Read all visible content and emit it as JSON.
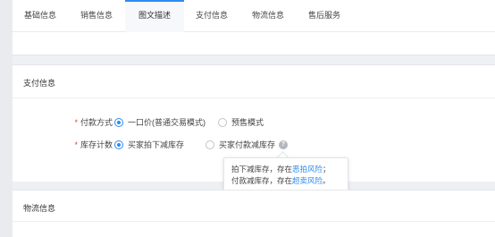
{
  "tabs": [
    {
      "label": "基础信息",
      "active": false
    },
    {
      "label": "销售信息",
      "active": false
    },
    {
      "label": "图文描述",
      "active": true
    },
    {
      "label": "支付信息",
      "active": false
    },
    {
      "label": "物流信息",
      "active": false
    },
    {
      "label": "售后服务",
      "active": false
    }
  ],
  "payment": {
    "title": "支付信息",
    "method": {
      "label": "付款方式",
      "options": [
        {
          "label": "一口价(普通交易模式)",
          "selected": true
        },
        {
          "label": "预售模式",
          "selected": false
        }
      ]
    },
    "inventory": {
      "label": "库存计数",
      "options": [
        {
          "label": "买家拍下减库存",
          "selected": true
        },
        {
          "label": "买家付款减库存",
          "selected": false
        }
      ],
      "help_icon": "question-icon"
    }
  },
  "tooltip": {
    "line1_prefix": "拍下减库存，存在",
    "line1_link": "恶拍风险",
    "line1_suffix": "；",
    "line2_prefix": "付款减库存，存在",
    "line2_link": "超卖风险",
    "line2_suffix": "。"
  },
  "logistics": {
    "title": "物流信息"
  },
  "colors": {
    "accent": "#2d8cf0",
    "required": "#e5403c",
    "background": "#eef0f3"
  }
}
